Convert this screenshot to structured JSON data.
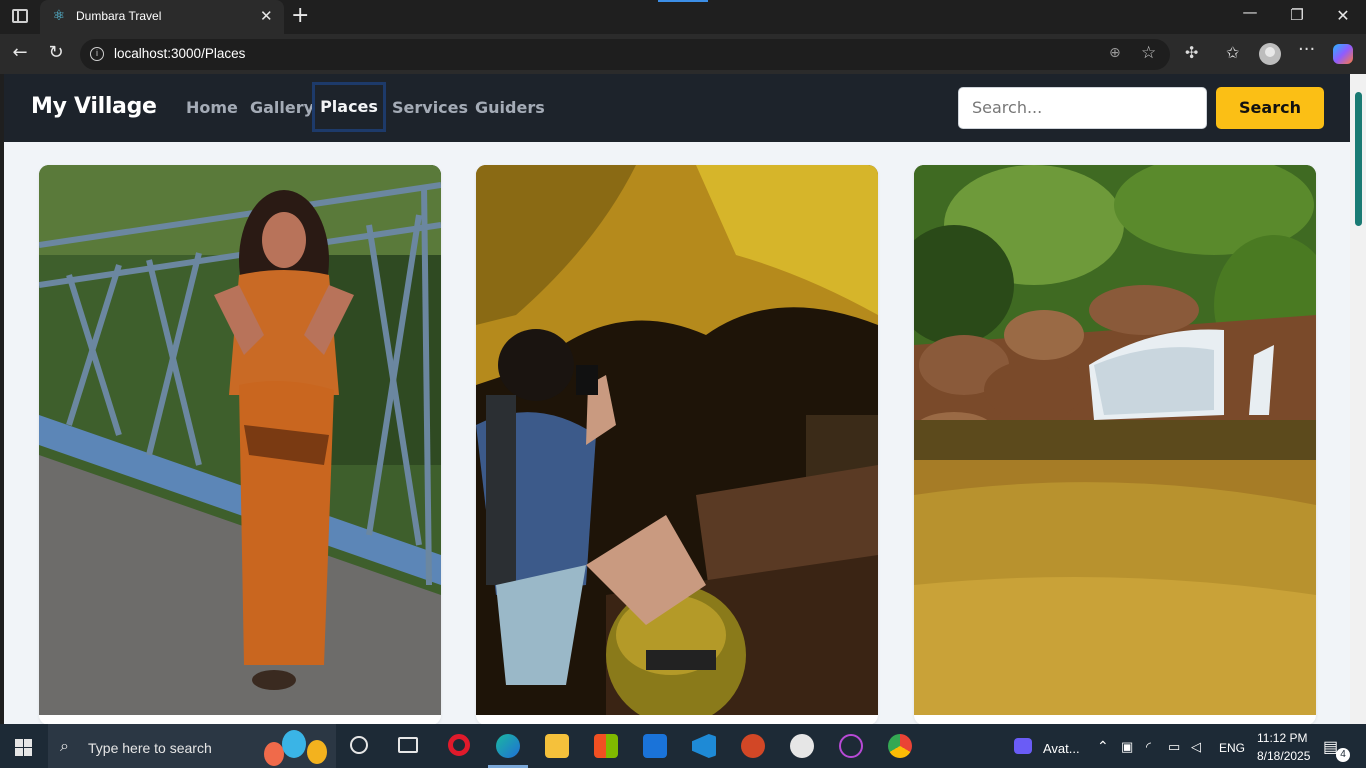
{
  "browser": {
    "tab_title": "Dumbara Travel",
    "tab_close": "✕",
    "new_tab": "+",
    "url": "localhost:3000/Places",
    "win_min": "—",
    "win_max": "❐",
    "win_close": "✕"
  },
  "site": {
    "brand": "My Village",
    "nav": {
      "home": "Home",
      "gallery": "Gallery",
      "places": "Places",
      "services": "Services",
      "guiders": "Guiders"
    },
    "search": {
      "placeholder": "Search...",
      "button": "Search"
    }
  },
  "taskbar": {
    "search_placeholder": "Type here to search",
    "tray_app": "Avat...",
    "language": "ENG",
    "time": "11:12 PM",
    "date": "8/18/2025",
    "notifications": "4"
  },
  "colors": {
    "accent_button": "#fbbf15",
    "navbar_bg": "#1d232b",
    "page_bg": "#f1f4f8"
  }
}
